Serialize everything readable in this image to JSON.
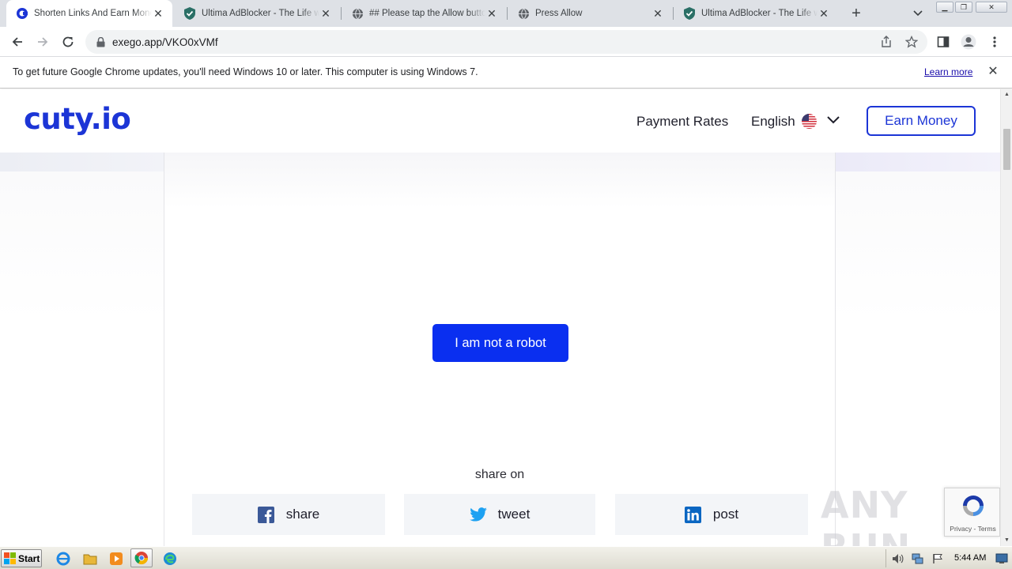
{
  "browser": {
    "tabs": [
      {
        "title": "Shorten Links And Earn Money",
        "active": true,
        "favicon": "cuty-favicon-icon"
      },
      {
        "title": "Ultima AdBlocker - The Life with",
        "active": false,
        "favicon": "shield-icon"
      },
      {
        "title": "## Please tap the Allow button",
        "active": false,
        "favicon": "globe-icon"
      },
      {
        "title": "Press Allow",
        "active": false,
        "favicon": "globe-icon"
      },
      {
        "title": "Ultima AdBlocker - The Life with",
        "active": false,
        "favicon": "shield-icon"
      }
    ],
    "url": "exego.app/VKO0xVMf",
    "infobar": {
      "message": "To get future Google Chrome updates, you'll need Windows 10 or later. This computer is using Windows 7.",
      "link": "Learn more"
    }
  },
  "site": {
    "logo": "cuty.io",
    "nav": {
      "payment_rates": "Payment Rates",
      "language": "English",
      "earn_money": "Earn Money"
    },
    "captcha_button": "I am not a robot",
    "share_label": "share on",
    "share_buttons": [
      {
        "label": "share",
        "icon": "facebook-icon",
        "color": "#3b5998"
      },
      {
        "label": "tweet",
        "icon": "twitter-icon",
        "color": "#1da1f2"
      },
      {
        "label": "post",
        "icon": "linkedin-icon",
        "color": "#0a66c2"
      }
    ],
    "colors": {
      "brand": "#1c35d6",
      "primary_button": "#0a2ff0"
    }
  },
  "overlay": {
    "watermark": "ANY RUN",
    "recaptcha": "Privacy - Terms"
  },
  "taskbar": {
    "start": "Start",
    "clock": "5:44 AM"
  }
}
